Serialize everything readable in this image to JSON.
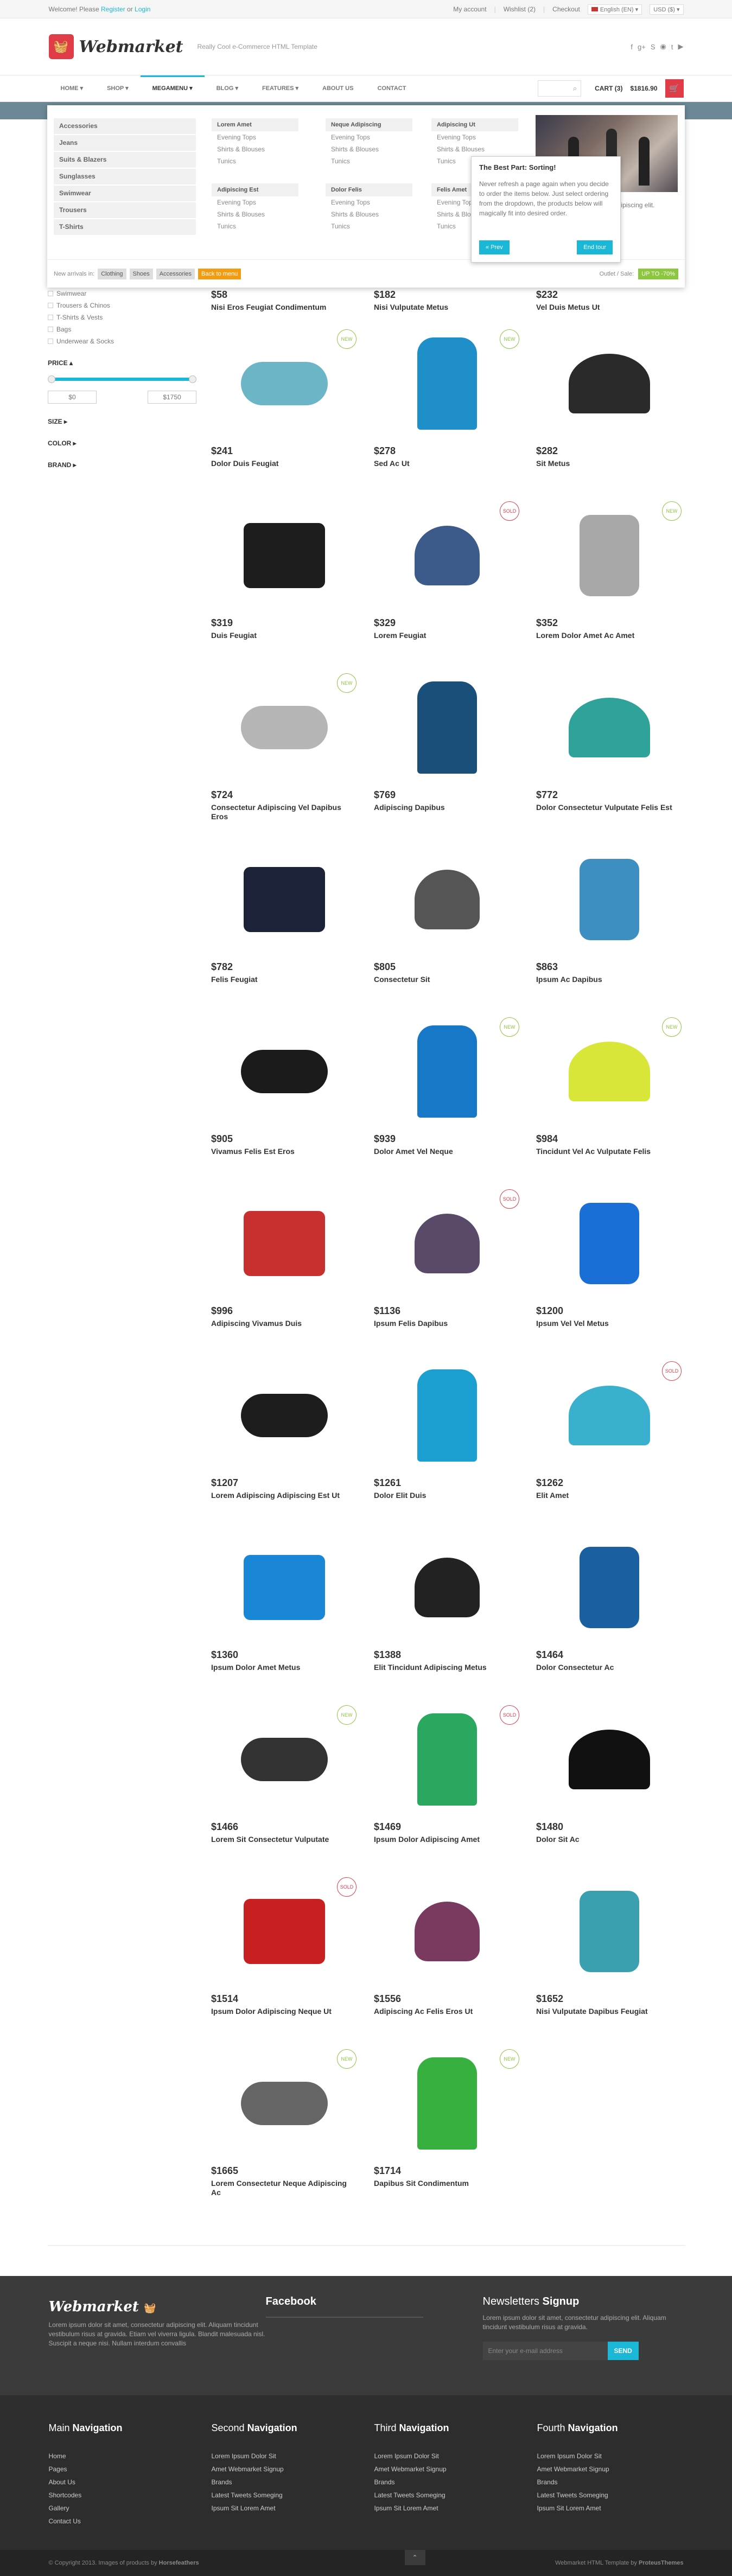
{
  "topbar": {
    "welcome": "Welcome! Please",
    "register": "Register",
    "or": "or",
    "login": "Login",
    "links": [
      "My account",
      "Wishlist (2)",
      "Checkout"
    ],
    "language": "English (EN)",
    "currency": "USD ($)"
  },
  "header": {
    "logo": "Webmarket",
    "tagline": "Really Cool e-Commerce HTML Template",
    "social": [
      "facebook-icon",
      "google-plus-icon",
      "skype-icon",
      "rss-icon",
      "twitter-icon",
      "youtube-icon"
    ]
  },
  "nav": {
    "items": [
      "HOME",
      "SHOP",
      "MEGAMENU",
      "BLOG",
      "FEATURES",
      "ABOUT US",
      "CONTACT"
    ],
    "cart_label": "CART (3)",
    "cart_total": "$1816.90"
  },
  "megamenu": {
    "categories": [
      "Accessories",
      "Jeans",
      "Suits & Blazers",
      "Sunglasses",
      "Swimwear",
      "Trousers",
      "T-Shirts"
    ],
    "columns": [
      {
        "title": "Lorem Amet",
        "links": [
          "Evening Tops",
          "Shirts & Blouses",
          "Tunics"
        ]
      },
      {
        "title": "Neque Adipiscing",
        "links": [
          "Evening Tops",
          "Shirts & Blouses",
          "Tunics"
        ]
      },
      {
        "title": "Adipiscing Ut",
        "links": [
          "Evening Tops",
          "Shirts & Blouses",
          "Tunics"
        ]
      },
      {
        "title": "Adipiscing Est",
        "links": [
          "Evening Tops",
          "Shirts & Blouses",
          "Tunics"
        ]
      },
      {
        "title": "Dolor Felis",
        "links": [
          "Evening Tops",
          "Shirts & Blouses",
          "Tunics"
        ]
      },
      {
        "title": "Felis Amet",
        "links": [
          "Evening Tops",
          "Shirts & Blouses",
          "Tunics"
        ]
      }
    ],
    "promo_text": "adipiscing elit. consectetur adipiscing elit. Aliquam ut sapiente",
    "new_arrivals_label": "New arrivals in:",
    "tags": [
      "Clothing",
      "Shoes",
      "Accessories"
    ],
    "back_label": "Back to menu",
    "outlet_label": "Outlet / Sale:",
    "outlet_badge": "UP TO -70%"
  },
  "tour": {
    "title": "The Best Part: Sorting!",
    "body": "Never refresh a page again when you decide to order the items below. Just select ordering from the dropdown, the products below will magically fit into desired order.",
    "prev": "« Prev",
    "end": "End tour"
  },
  "sidebar": {
    "checkboxes": [
      "Swimwear",
      "Trousers & Chinos",
      "T-Shirts & Vests",
      "Bags",
      "Underwear & Socks"
    ],
    "price_title": "PRICE",
    "price_min": "$0",
    "price_max": "$1750",
    "size_title": "SIZE",
    "color_title": "COLOR",
    "brand_title": "BRAND"
  },
  "products": [
    {
      "price": "$58",
      "name": "Nisi Eros Feugiat Condimentum",
      "badge": "",
      "color": "#888"
    },
    {
      "price": "$182",
      "name": "Nisi Vulputate Metus",
      "badge": "",
      "color": "#888"
    },
    {
      "price": "$232",
      "name": "Vel Duis Metus Ut",
      "badge": "",
      "color": "#888"
    },
    {
      "price": "$241",
      "name": "Dolor Duis Feugiat",
      "badge": "NEW",
      "color": "#6bb5c7"
    },
    {
      "price": "$278",
      "name": "Sed Ac Ut",
      "badge": "NEW",
      "color": "#1e8fc8"
    },
    {
      "price": "$282",
      "name": "Sit Metus",
      "badge": "",
      "color": "#2a2a2a"
    },
    {
      "price": "$319",
      "name": "Duis Feugiat",
      "badge": "",
      "color": "#1d1d1d"
    },
    {
      "price": "$329",
      "name": "Lorem Feugiat",
      "badge": "SOLD",
      "color": "#3d5b8a"
    },
    {
      "price": "$352",
      "name": "Lorem Dolor Amet Ac Amet",
      "badge": "NEW",
      "color": "#a8a8a8"
    },
    {
      "price": "$724",
      "name": "Consectetur Adipiscing Vel Dapibus Eros",
      "badge": "NEW",
      "color": "#b5b5b5"
    },
    {
      "price": "$769",
      "name": "Adipiscing Dapibus",
      "badge": "",
      "color": "#1a4f7a"
    },
    {
      "price": "$772",
      "name": "Dolor Consectetur Vulputate Felis Est",
      "badge": "",
      "color": "#2fa39a"
    },
    {
      "price": "$782",
      "name": "Felis Feugiat",
      "badge": "",
      "color": "#1c2238"
    },
    {
      "price": "$805",
      "name": "Consectetur Sit",
      "badge": "",
      "color": "#555"
    },
    {
      "price": "$863",
      "name": "Ipsum Ac Dapibus",
      "badge": "",
      "color": "#3c8fc0"
    },
    {
      "price": "$905",
      "name": "Vivamus Felis Est Eros",
      "badge": "",
      "color": "#1b1b1b"
    },
    {
      "price": "$939",
      "name": "Dolor Amet Vel Neque",
      "badge": "NEW",
      "color": "#1878c8"
    },
    {
      "price": "$984",
      "name": "Tincidunt Vel Ac Vulputate Felis",
      "badge": "NEW",
      "color": "#d8e63a"
    },
    {
      "price": "$996",
      "name": "Adipiscing Vivamus Duis",
      "badge": "",
      "color": "#c83030"
    },
    {
      "price": "$1136",
      "name": "Ipsum Felis Dapibus",
      "badge": "SOLD",
      "color": "#5a4a6a"
    },
    {
      "price": "$1200",
      "name": "Ipsum Vel Vel Metus",
      "badge": "",
      "color": "#1a6fd6"
    },
    {
      "price": "$1207",
      "name": "Lorem Adipiscing Adipiscing Est Ut",
      "badge": "",
      "color": "#1d1d1d"
    },
    {
      "price": "$1261",
      "name": "Dolor Elit Duis",
      "badge": "",
      "color": "#1a9fd0"
    },
    {
      "price": "$1262",
      "name": "Elit Amet",
      "badge": "SOLD",
      "color": "#3ab0cf"
    },
    {
      "price": "$1360",
      "name": "Ipsum Dolor Amet Metus",
      "badge": "",
      "color": "#1a86d6"
    },
    {
      "price": "$1388",
      "name": "Elit Tincidunt Adipiscing Metus",
      "badge": "",
      "color": "#222"
    },
    {
      "price": "$1464",
      "name": "Dolor Consectetur Ac",
      "badge": "",
      "color": "#1a5fa0"
    },
    {
      "price": "$1466",
      "name": "Lorem Sit Consectetur Vulputate",
      "badge": "NEW",
      "color": "#333"
    },
    {
      "price": "$1469",
      "name": "Ipsum Dolor Adipiscing Amet",
      "badge": "SOLD",
      "color": "#2aa860"
    },
    {
      "price": "$1480",
      "name": "Dolor Sit Ac",
      "badge": "",
      "color": "#111"
    },
    {
      "price": "$1514",
      "name": "Ipsum Dolor Adipiscing Neque Ut",
      "badge": "SOLD",
      "color": "#c82020"
    },
    {
      "price": "$1556",
      "name": "Adipiscing Ac Felis Eros Ut",
      "badge": "",
      "color": "#7a3a60"
    },
    {
      "price": "$1652",
      "name": "Nisi Vulputate Dapibus Feugiat",
      "badge": "",
      "color": "#3aa0b0"
    },
    {
      "price": "$1665",
      "name": "Lorem Consectetur Neque Adipiscing Ac",
      "badge": "NEW",
      "color": "#666"
    },
    {
      "price": "$1714",
      "name": "Dapibus Sit Condimentum",
      "badge": "NEW",
      "color": "#38b040"
    }
  ],
  "footer": {
    "logo": "Webmarket",
    "about": "Lorem ipsum dolor sit amet, consectetur adipiscing elit. Aliquam tincidunt vestibulum risus at gravida. Etiam vel viverra ligula. Blandit malesuada nisl. Suscipit a neque nisi. Nullam interdum convallis",
    "facebook_title": "Facebook",
    "newsletter_title": "Newsletters",
    "newsletter_bold": "Signup",
    "newsletter_text": "Lorem ipsum dolor sit amet, consectetur adipiscing elit. Aliquam tincidunt vestibulum risus at gravida.",
    "newsletter_placeholder": "Enter your e-mail address",
    "send": "SEND",
    "columns": [
      {
        "pre": "Main",
        "title": "Navigation",
        "links": [
          "Home",
          "Pages",
          "About Us",
          "Shortcodes",
          "Gallery",
          "Contact Us"
        ]
      },
      {
        "pre": "Second",
        "title": "Navigation",
        "links": [
          "Lorem Ipsum Dolor Sit",
          "Amet Webmarket Signup",
          "Brands",
          "Latest Tweets Someging",
          "Ipsum Sit Lorem Amet"
        ]
      },
      {
        "pre": "Third",
        "title": "Navigation",
        "links": [
          "Lorem Ipsum Dolor Sit",
          "Amet Webmarket Signup",
          "Brands",
          "Latest Tweets Someging",
          "Ipsum Sit Lorem Amet"
        ]
      },
      {
        "pre": "Fourth",
        "title": "Navigation",
        "links": [
          "Lorem Ipsum Dolor Sit",
          "Amet Webmarket Signup",
          "Brands",
          "Latest Tweets Someging",
          "Ipsum Sit Lorem Amet"
        ]
      }
    ],
    "copyright": "© Copyright 2013. Images of products by",
    "copyright_bold": "Horsefeathers",
    "credit": "Webmarket HTML Template by",
    "credit_bold": "ProteusThemes"
  }
}
